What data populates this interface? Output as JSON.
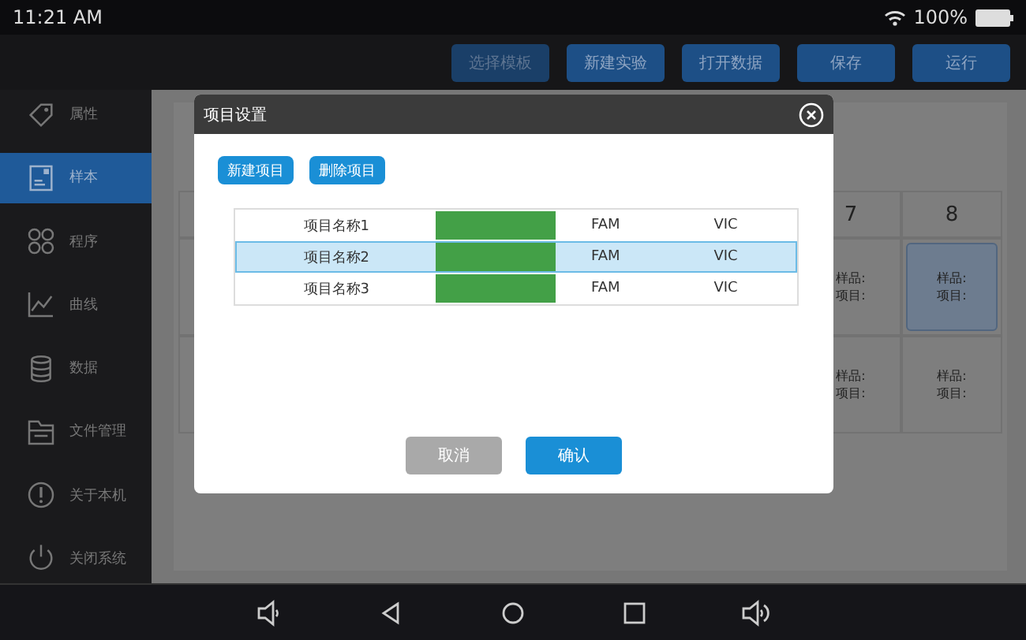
{
  "status_bar": {
    "time": "11:21 AM",
    "battery": "100%"
  },
  "toolbar": {
    "buttons": [
      {
        "label": "选择模板",
        "disabled": true
      },
      {
        "label": "新建实验",
        "disabled": false
      },
      {
        "label": "打开数据",
        "disabled": false
      },
      {
        "label": "保存",
        "disabled": false
      },
      {
        "label": "运行",
        "disabled": false
      }
    ]
  },
  "sidebar": {
    "items": [
      {
        "label": "属性",
        "selected": false
      },
      {
        "label": "样本",
        "selected": true
      },
      {
        "label": "程序",
        "selected": false
      },
      {
        "label": "曲线",
        "selected": false
      },
      {
        "label": "数据",
        "selected": false
      },
      {
        "label": "文件管理",
        "selected": false
      },
      {
        "label": "关于本机",
        "selected": false
      },
      {
        "label": "关闭系统",
        "selected": false
      }
    ]
  },
  "plate": {
    "columns": [
      "7",
      "8"
    ],
    "rows": [
      [
        {
          "sample": "样品:",
          "item": "项目:",
          "selected": false
        },
        {
          "sample": "样品:",
          "item": "项目:",
          "selected": true
        }
      ],
      [
        {
          "sample": "样品:",
          "item": "项目:",
          "selected": false
        },
        {
          "sample": "样品:",
          "item": "项目:",
          "selected": false
        }
      ]
    ]
  },
  "dialog": {
    "title": "项目设置",
    "actions": [
      "新建项目",
      "删除项目"
    ],
    "rows": [
      {
        "name": "项目名称1",
        "color": "#43a047",
        "dye1": "FAM",
        "dye2": "VIC",
        "selected": false
      },
      {
        "name": "项目名称2",
        "color": "#43a047",
        "dye1": "FAM",
        "dye2": "VIC",
        "selected": true
      },
      {
        "name": "项目名称3",
        "color": "#43a047",
        "dye1": "FAM",
        "dye2": "VIC",
        "selected": false
      }
    ],
    "cancel": {
      "label": "取消",
      "disabled": true
    },
    "confirm": {
      "label": "确认"
    }
  }
}
